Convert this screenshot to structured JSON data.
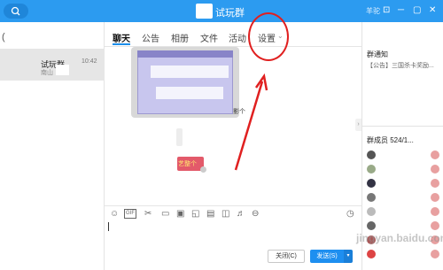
{
  "window": {
    "title": "试玩群",
    "user_name": "羊驼",
    "controls": [
      "⊡",
      "─",
      "▢",
      "✕"
    ]
  },
  "chat_list": {
    "items": [
      {
        "name": "试玩群",
        "time": "10:42",
        "subtitle": "南山"
      }
    ]
  },
  "tabs": [
    {
      "label": "聊天",
      "active": true
    },
    {
      "label": "公告"
    },
    {
      "label": "相册"
    },
    {
      "label": "文件"
    },
    {
      "label": "活动"
    },
    {
      "label": "设置"
    }
  ],
  "messages": {
    "image_label": "影个",
    "sticker_text": "艺整个"
  },
  "composer": {
    "close_label": "关闭(C)",
    "send_label": "发送(S)"
  },
  "right_panel": {
    "notice_title": "群通知",
    "notice_text": "【公告】三国杀卡奖励...",
    "members_title": "群成员 524/1..."
  },
  "watermark": "jingyan.baidu.com",
  "colors": {
    "titlebar": "#2c9bf0",
    "accent": "#1d8eea",
    "annotation": "#e02020"
  }
}
